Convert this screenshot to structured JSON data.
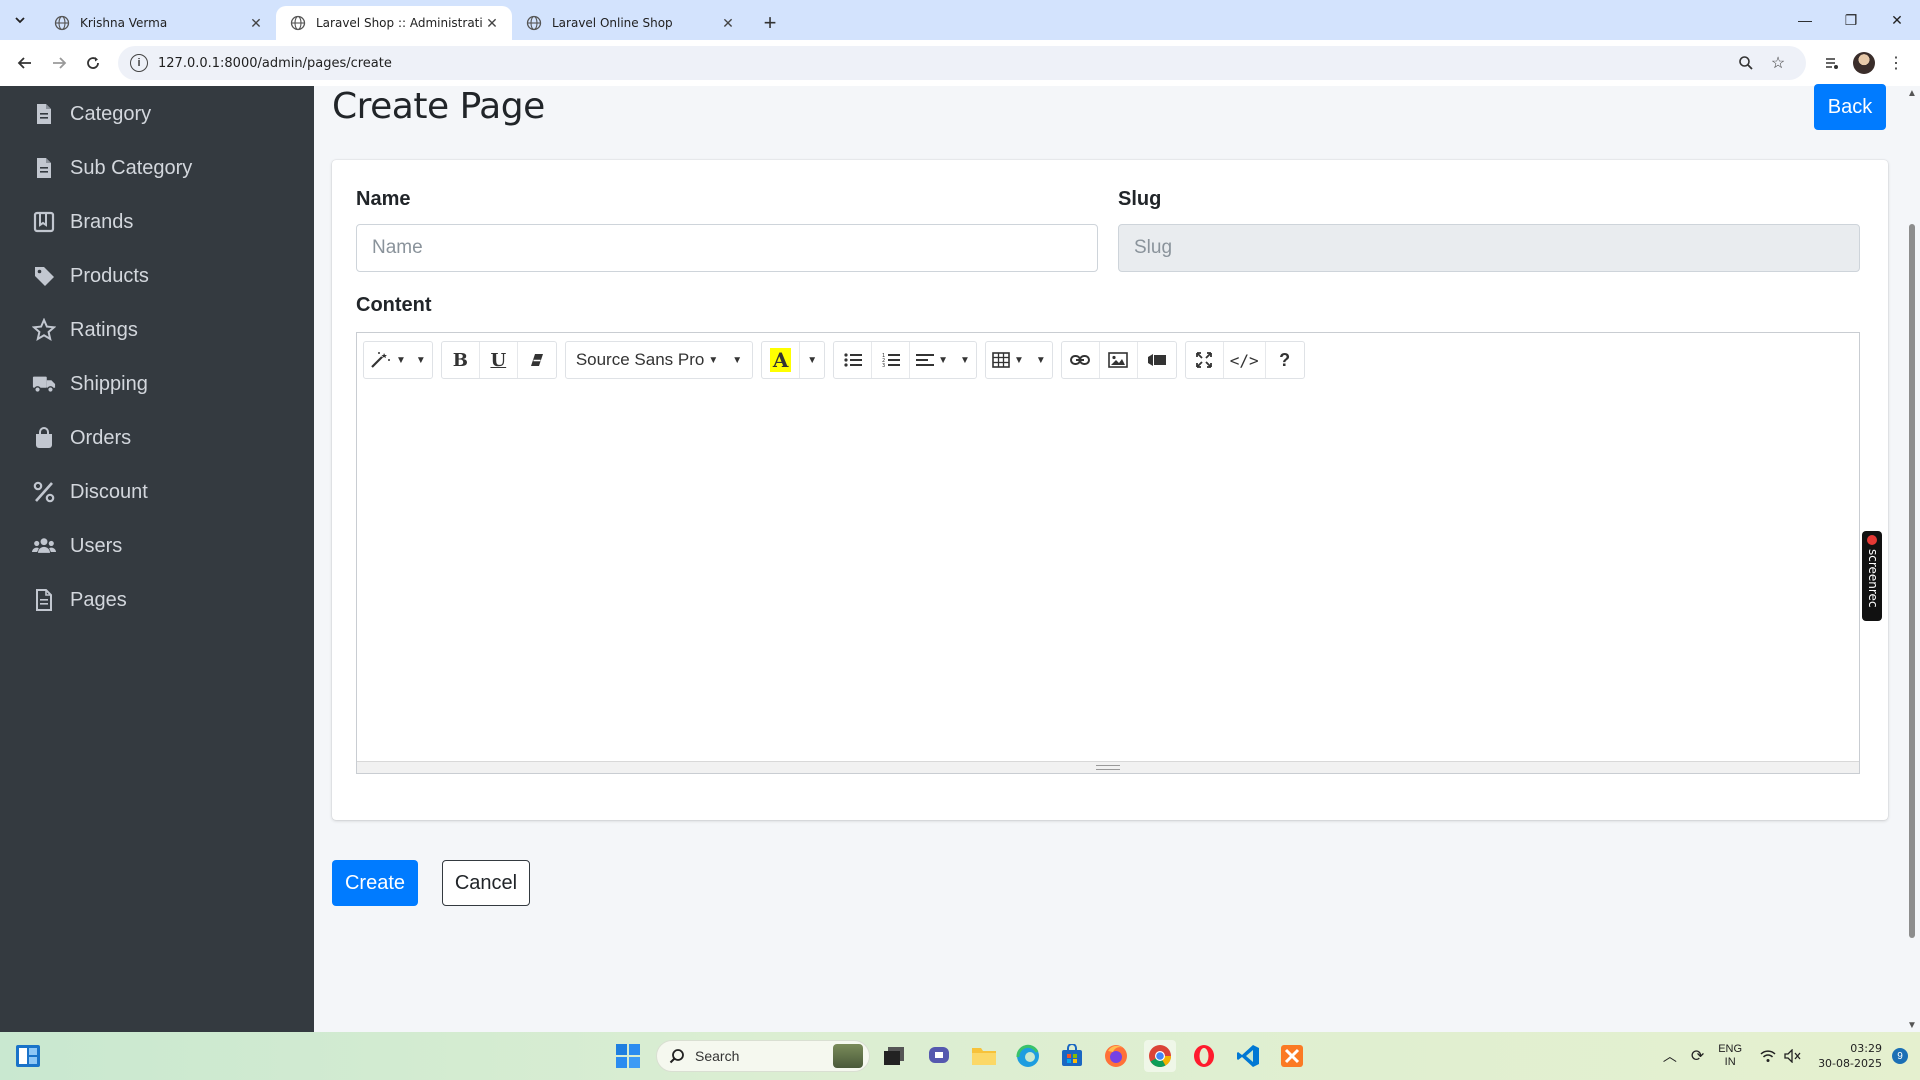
{
  "browser": {
    "tabs": [
      {
        "label": "Krishna Verma",
        "active": false
      },
      {
        "label": "Laravel Shop :: Administrative P",
        "active": true
      },
      {
        "label": "Laravel Online Shop",
        "active": false
      }
    ],
    "url": "127.0.0.1:8000/admin/pages/create"
  },
  "sidebar": {
    "items": [
      {
        "label": "Category",
        "icon": "file-icon"
      },
      {
        "label": "Sub Category",
        "icon": "file-icon"
      },
      {
        "label": "Brands",
        "icon": "book-icon"
      },
      {
        "label": "Products",
        "icon": "tag-icon"
      },
      {
        "label": "Ratings",
        "icon": "star-icon"
      },
      {
        "label": "Shipping",
        "icon": "truck-icon"
      },
      {
        "label": "Orders",
        "icon": "shopping-bag-icon"
      },
      {
        "label": "Discount",
        "icon": "percent-icon"
      },
      {
        "label": "Users",
        "icon": "users-icon"
      },
      {
        "label": "Pages",
        "icon": "file-text-icon"
      }
    ]
  },
  "page": {
    "title": "Create Page",
    "back_label": "Back",
    "name_label": "Name",
    "name_placeholder": "Name",
    "slug_label": "Slug",
    "slug_placeholder": "Slug",
    "content_label": "Content",
    "font_family": "Source Sans Pro",
    "create_label": "Create",
    "cancel_label": "Cancel"
  },
  "screenrec": {
    "label": "screenrec"
  },
  "taskbar": {
    "search_label": "Search",
    "language_line1": "ENG",
    "language_line2": "IN",
    "time": "03:29",
    "date": "30-08-2025",
    "notification_count": "9"
  },
  "colors": {
    "primary": "#007bff",
    "sidebar_bg": "#343a40",
    "tabstrip_bg": "#d3e3fd"
  }
}
